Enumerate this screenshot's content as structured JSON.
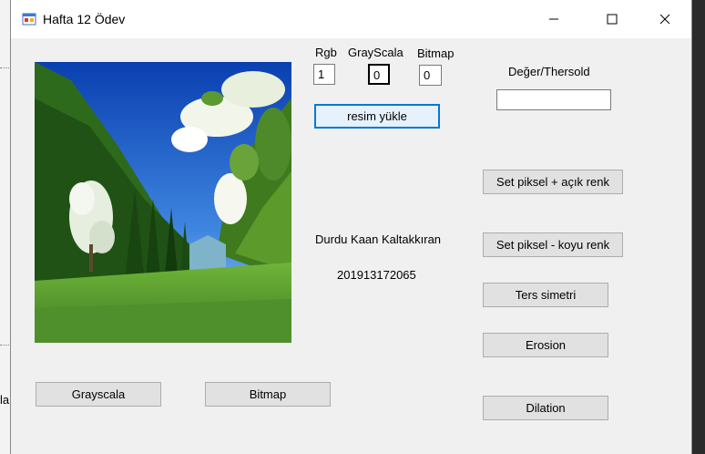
{
  "window": {
    "title": "Hafta 12 Ödev"
  },
  "background": {
    "fragment_text": "la"
  },
  "inputs": {
    "rgb": {
      "label": "Rgb",
      "value": "1"
    },
    "grayscala": {
      "label": "GrayScala",
      "value": "0"
    },
    "bitmap": {
      "label": "Bitmap",
      "value": "0"
    },
    "threshold": {
      "label": "Değer/Thersold",
      "value": ""
    }
  },
  "buttons": {
    "load_image": "resim yükle",
    "set_pixel_light": "Set piksel + açık renk",
    "set_pixel_dark": "Set piksel - koyu renk",
    "reverse_symmetry": "Ters simetri",
    "erosion": "Erosion",
    "dilation": "Dilation",
    "grayscale": "Grayscala",
    "bitmap": "Bitmap"
  },
  "info": {
    "author": "Durdu Kaan Kaltakkıran",
    "student_id": "201913172065"
  },
  "icons": {
    "app": "app-window-icon",
    "minimize": "minimize-icon",
    "maximize": "maximize-icon",
    "close": "close-icon"
  }
}
